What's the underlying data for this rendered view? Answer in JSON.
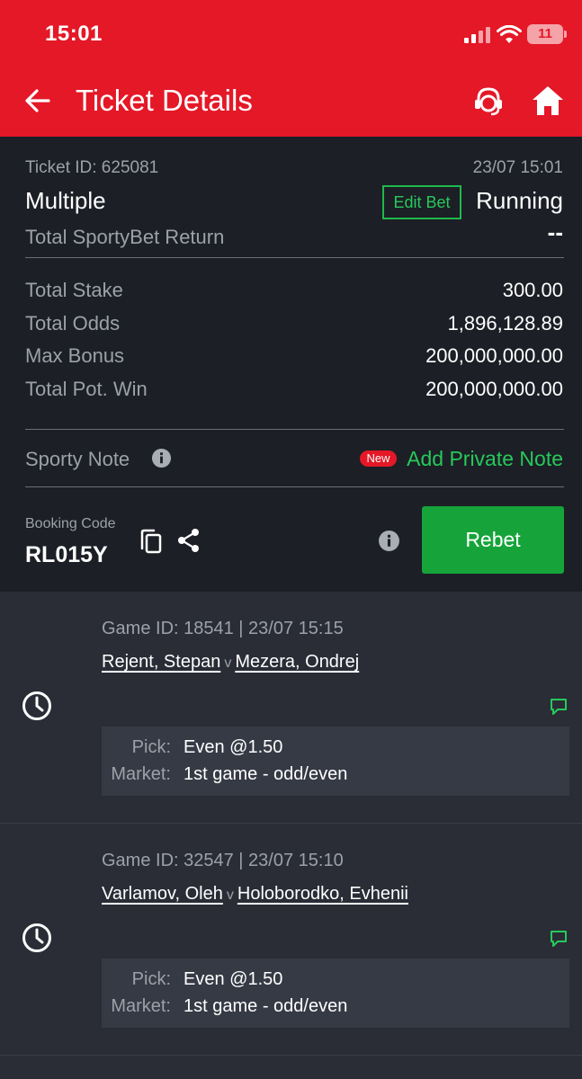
{
  "status_bar": {
    "time": "15:01",
    "battery": "11"
  },
  "header": {
    "title": "Ticket Details"
  },
  "ticket": {
    "id_label": "Ticket ID: 625081",
    "datetime": "23/07 15:01",
    "type": "Multiple",
    "edit_bet_label": "Edit Bet",
    "status": "Running",
    "return_label": "Total SportyBet Return",
    "return_value": "--",
    "rows": [
      {
        "label": "Total Stake",
        "value": "300.00"
      },
      {
        "label": "Total Odds",
        "value": "1,896,128.89"
      },
      {
        "label": "Max Bonus",
        "value": "200,000,000.00"
      },
      {
        "label": "Total Pot. Win",
        "value": "200,000,000.00"
      }
    ],
    "note_label": "Sporty Note",
    "new_badge": "New",
    "add_note_label": "Add Private Note",
    "booking_label": "Booking Code",
    "booking_code": "RL015Y",
    "rebet_label": "Rebet"
  },
  "selections": [
    {
      "meta": "Game ID: 18541 | 23/07 15:15",
      "home": "Rejent, Stepan",
      "vs": "v",
      "away": "Mezera, Ondrej",
      "pick_label": "Pick:",
      "pick": "Even @1.50",
      "market_label": "Market:",
      "market": "1st game - odd/even"
    },
    {
      "meta": "Game ID: 32547 | 23/07 15:10",
      "home": "Varlamov, Oleh",
      "vs": "v",
      "away": "Holoborodko, Evhenii",
      "pick_label": "Pick:",
      "pick": "Even @1.50",
      "market_label": "Market:",
      "market": "1st game - odd/even"
    }
  ],
  "colors": {
    "brand": "#e41827",
    "accent_green": "#16a43a",
    "panel": "#1c1f26"
  }
}
